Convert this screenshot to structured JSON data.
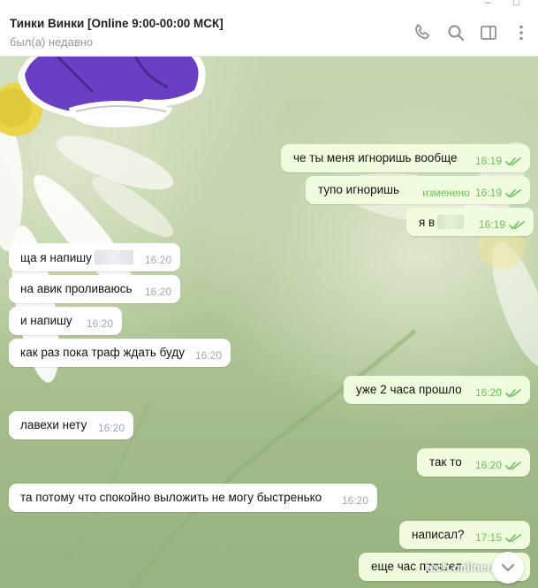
{
  "window": {
    "minimize_glyph": "–",
    "close_glyph": "□"
  },
  "header": {
    "title": "Тинки Винки [Online 9:00-00:00 МСК]",
    "status": "был(а) недавно",
    "icons": [
      "phone-icon",
      "search-icon",
      "sidebar-toggle-icon",
      "more-vertical-icon"
    ],
    "icon_color": "#8a9199"
  },
  "colors": {
    "incoming_bubble": "#ffffff",
    "outgoing_bubble": "#effdde",
    "outgoing_meta": "#6cbf5f",
    "incoming_meta": "#a0acb6"
  },
  "messages": [
    {
      "id": "m1",
      "direction": "out",
      "text": "че ты меня игноришь вообще",
      "time": "16:19",
      "read": true
    },
    {
      "id": "m2",
      "direction": "out",
      "text": "тупо игноришь",
      "edited": "изменено",
      "time": "16:19",
      "read": true
    },
    {
      "id": "m3",
      "direction": "out",
      "text": "я в",
      "redacted": true,
      "time": "16:19",
      "read": true
    },
    {
      "id": "m4",
      "direction": "in",
      "text": "ща я напишу",
      "redacted": true,
      "time": "16:20"
    },
    {
      "id": "m5",
      "direction": "in",
      "text": "на авик проливаюсь",
      "time": "16:20"
    },
    {
      "id": "m6",
      "direction": "in",
      "text": "и напишу",
      "time": "16:20"
    },
    {
      "id": "m7",
      "direction": "in",
      "text": "как раз пока траф ждать буду",
      "time": "16:20"
    },
    {
      "id": "m8",
      "direction": "out",
      "text": "уже 2 часа прошло",
      "time": "16:20",
      "read": true
    },
    {
      "id": "m9",
      "direction": "in",
      "text": "лавехи нету",
      "time": "16:20"
    },
    {
      "id": "m10",
      "direction": "out",
      "text": "так то",
      "time": "16:20",
      "read": true
    },
    {
      "id": "m11",
      "direction": "in",
      "text": "та потому что спокойно выложить не могу быстренько",
      "time": "16:20"
    },
    {
      "id": "m12",
      "direction": "out",
      "text": "написал?",
      "time": "17:15",
      "read": true
    },
    {
      "id": "m13",
      "direction": "out",
      "text": "еще час прошел",
      "time": ""
    }
  ],
  "watermark": "tech.onliner.by",
  "scroll_down_icon": "chevron-down-icon"
}
